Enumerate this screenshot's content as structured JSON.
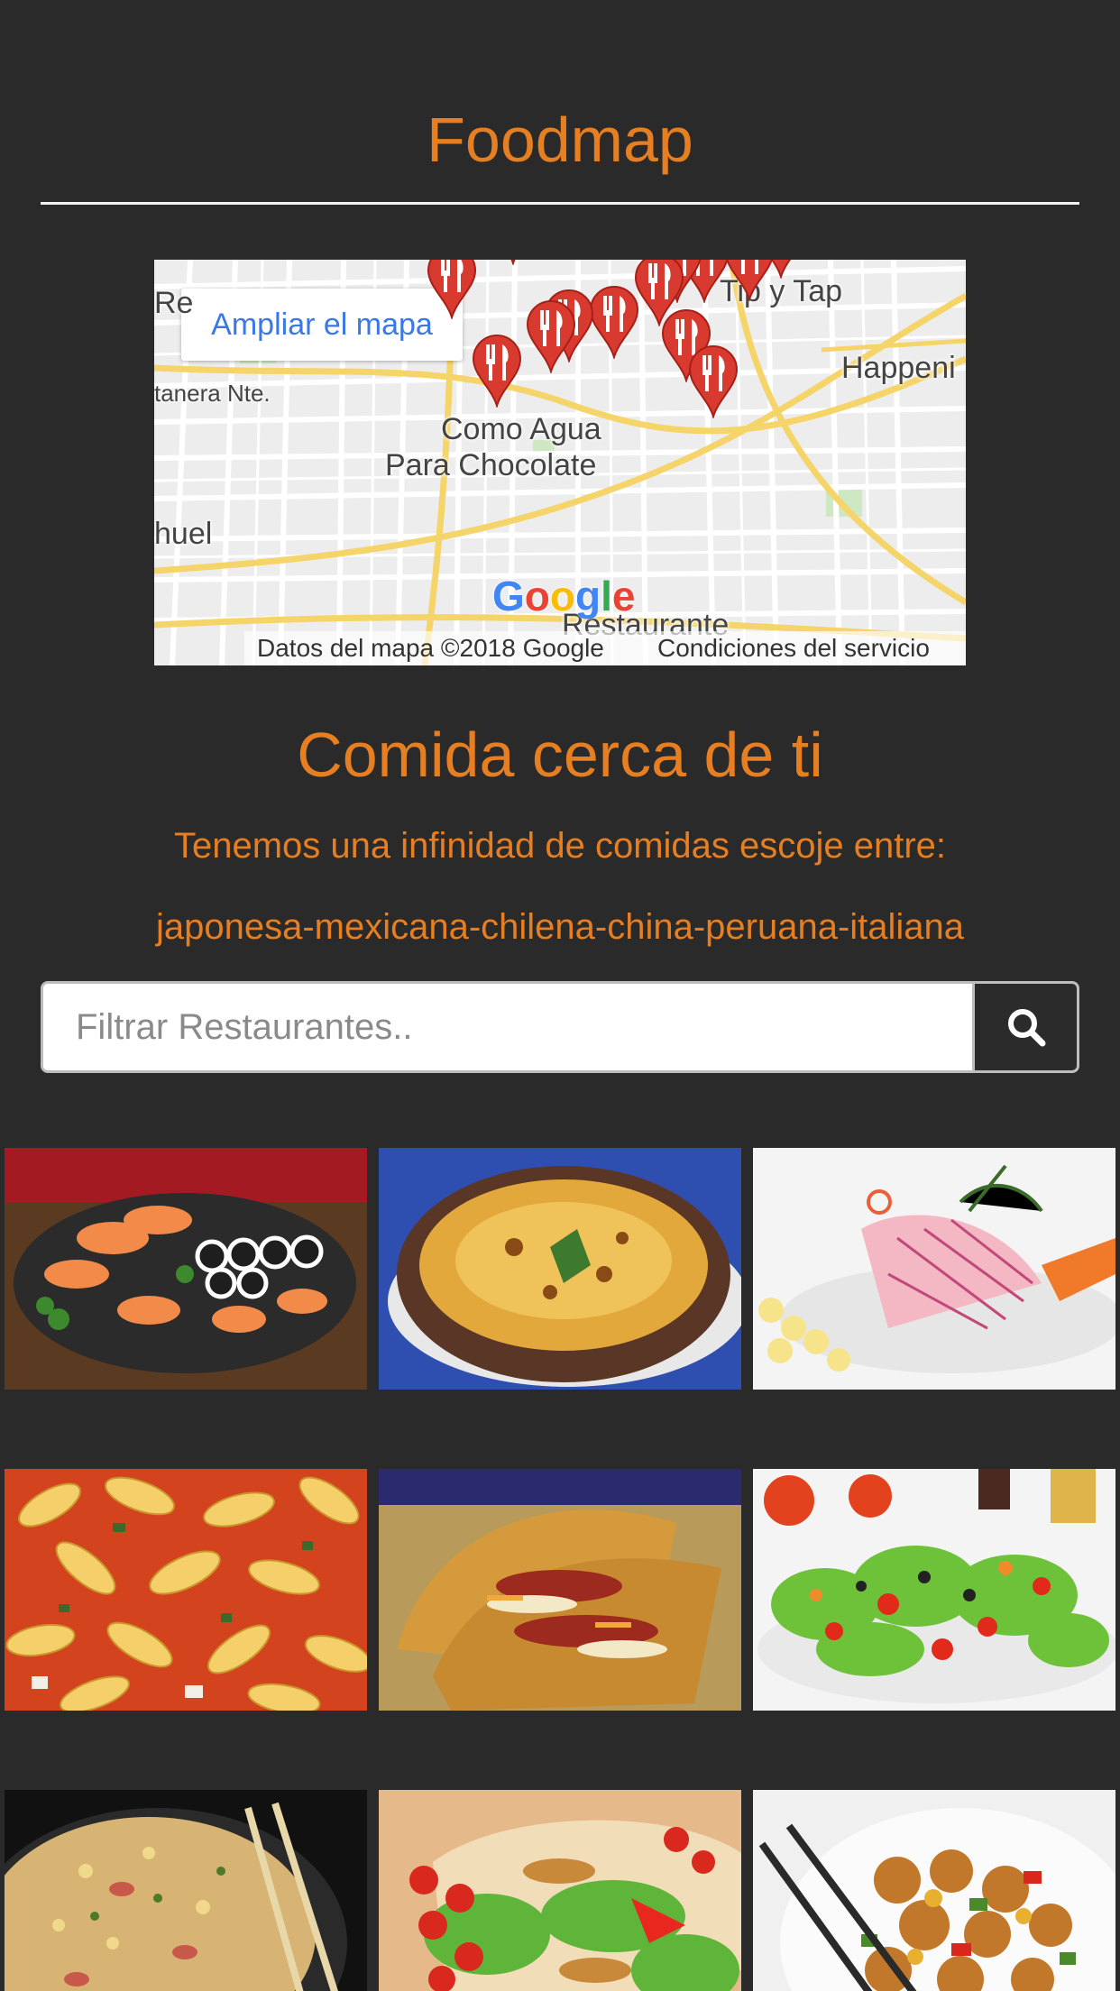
{
  "app": {
    "title": "Foodmap"
  },
  "map": {
    "expand_label": "Ampliar el mapa",
    "labels": [
      "Tip y Tap",
      "Happeni",
      "tanera Nte.",
      "Como Agua",
      "Para Chocolate",
      "huel",
      "Restaurante",
      "Re"
    ],
    "google_logo": "Google",
    "attribution": "Datos del mapa ©2018 Google",
    "terms": "Condiciones del servicio",
    "marker_icon": "restaurant-marker-icon"
  },
  "section": {
    "title": "Comida cerca de ti",
    "intro": "Tenemos una infinidad de comidas escoje entre:",
    "cuisines": "japonesa-mexicana-chilena-china-peruana-italiana"
  },
  "search": {
    "placeholder": "Filtrar Restaurantes..",
    "button_icon": "search-icon"
  },
  "foods": [
    {
      "name": "sushi",
      "label": "sushi"
    },
    {
      "name": "pastel-de-choclo",
      "label": "pastel de choclo"
    },
    {
      "name": "ceviche",
      "label": "ceviche"
    },
    {
      "name": "pasta-fusilli",
      "label": "pasta"
    },
    {
      "name": "tacos",
      "label": "tacos"
    },
    {
      "name": "ensalada",
      "label": "ensalada"
    },
    {
      "name": "arroz-chaufa",
      "label": "arroz chaufa"
    },
    {
      "name": "wraps",
      "label": "wraps"
    },
    {
      "name": "pollo-agridulce",
      "label": "pollo agridulce"
    }
  ],
  "colors": {
    "background": "#2a2a2a",
    "accent": "#e67e22",
    "marker": "#d93a2f",
    "link": "#3b78e7"
  }
}
